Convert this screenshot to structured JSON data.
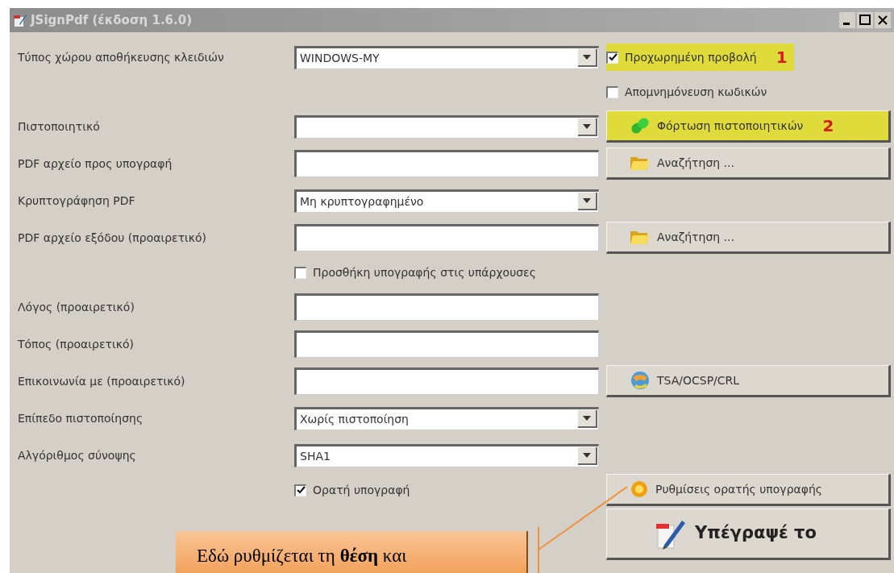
{
  "window": {
    "title": "JSignPdf (έκδοση 1.6.0)"
  },
  "rows": [
    {
      "label": "Τύπος χώρου αποθήκευσης κλειδιών",
      "field": {
        "kind": "dropdown",
        "value": "WINDOWS-MY"
      },
      "side": {
        "kind": "checkbox",
        "label": "Προχωρημένη προβολή",
        "checked": true,
        "highlighted": true,
        "marker": "1"
      }
    },
    {
      "side": {
        "kind": "checkbox",
        "label": "Απομνημόνευση κωδικών",
        "checked": false,
        "highlighted": false
      }
    },
    {
      "label": "Πιστοποιητικό",
      "field": {
        "kind": "dropdown"
      },
      "side": {
        "kind": "load",
        "label": "Φόρτωση πιστοποιητικών",
        "highlighted": true,
        "marker": "2"
      }
    },
    {
      "label": "PDF αρχείο προς υπογραφή",
      "field": {
        "kind": "text"
      },
      "side": {
        "kind": "browse",
        "label": "Αναζήτηση ...",
        "highlighted": false
      }
    },
    {
      "label": "Κρυπτογράφηση PDF",
      "field": {
        "kind": "dropdown",
        "value": "Μη κρυπτογραφημένο"
      }
    },
    {
      "label": "PDF αρχείο εξόδου (προαιρετικό)",
      "field": {
        "kind": "text"
      },
      "side": {
        "kind": "browse",
        "label": "Αναζήτηση ...",
        "highlighted": false
      }
    },
    {
      "field": {
        "kind": "checkbox",
        "label": "Προσθήκη υπογραφής στις υπάρχουσες",
        "checked": false
      }
    },
    {
      "label": "Λόγος (προαιρετικό)",
      "field": {
        "kind": "text"
      }
    },
    {
      "label": "Τόπος (προαιρετικό)",
      "field": {
        "kind": "text"
      }
    },
    {
      "label": "Επικοινωνία με (προαιρετικό)",
      "field": {
        "kind": "text"
      },
      "side": {
        "kind": "network",
        "label": "TSA/OCSP/CRL",
        "highlighted": false
      }
    },
    {
      "label": "Επίπεδο πιστοποίησης",
      "field": {
        "kind": "dropdown",
        "value": "Χωρίς πιστοποίηση"
      }
    },
    {
      "label": "Αλγόριθμος σύνοψης",
      "field": {
        "kind": "dropdown",
        "value": "SHA1"
      }
    },
    {
      "field": {
        "kind": "checkbox",
        "label": "Ορατή υπογραφή",
        "checked": true
      },
      "side": {
        "kind": "appearance",
        "label": "Ρυθμίσεις ορατής υπογραφής",
        "highlighted": false
      }
    },
    {
      "side": {
        "kind": "sign",
        "label": "Υπέγραψέ το",
        "highlighted": false
      }
    }
  ],
  "callout": {
    "text": "Εδώ ρυθμίζεται τη **θέση** και"
  }
}
